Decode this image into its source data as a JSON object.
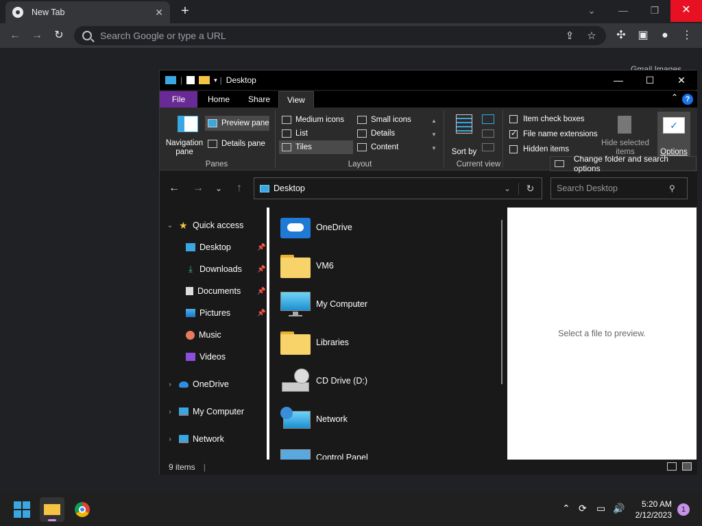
{
  "browser": {
    "tab_title": "New Tab",
    "tab_close": "✕",
    "new_tab": "+",
    "omnibox_placeholder": "Search Google or type a URL",
    "bookmarks_partial": "Gmail   Images",
    "icons": [
      "back-icon",
      "forward-icon",
      "reload-icon",
      "share-icon",
      "star-icon",
      "extensions-icon",
      "sidepanel-icon",
      "profile-icon",
      "menu-icon"
    ]
  },
  "explorer": {
    "title": "Desktop",
    "ribbon_tabs": [
      "File",
      "Home",
      "Share",
      "View"
    ],
    "panes": {
      "navigation_pane": "Navigation pane",
      "preview_pane": "Preview pane",
      "details_pane": "Details pane",
      "group": "Panes"
    },
    "layout": {
      "medium_icons": "Medium icons",
      "small_icons": "Small icons",
      "list": "List",
      "details": "Details",
      "tiles": "Tiles",
      "content": "Content",
      "group": "Layout"
    },
    "current_view": {
      "sort_by": "Sort by",
      "group": "Current view"
    },
    "show_hide": {
      "item_check_boxes": "Item check boxes",
      "file_name_extensions": "File name extensions",
      "hidden_items": "Hidden items",
      "hide_selected_items": "Hide selected items",
      "options": "Options"
    },
    "tooltip": "Change folder and search options",
    "address": "Desktop",
    "search_placeholder": "Search Desktop",
    "nav": {
      "quick_access": "Quick access",
      "items": [
        "Desktop",
        "Downloads",
        "Documents",
        "Pictures",
        "Music",
        "Videos"
      ],
      "onedrive": "OneDrive",
      "my_computer": "My Computer",
      "network": "Network"
    },
    "files": [
      "OneDrive",
      "VM6",
      "My Computer",
      "Libraries",
      "CD Drive (D:)",
      "Network",
      "Control Panel"
    ],
    "preview_text": "Select a file to preview.",
    "status": "9 items"
  },
  "taskbar": {
    "time": "5:20 AM",
    "date": "2/12/2023",
    "notifications": "1"
  }
}
